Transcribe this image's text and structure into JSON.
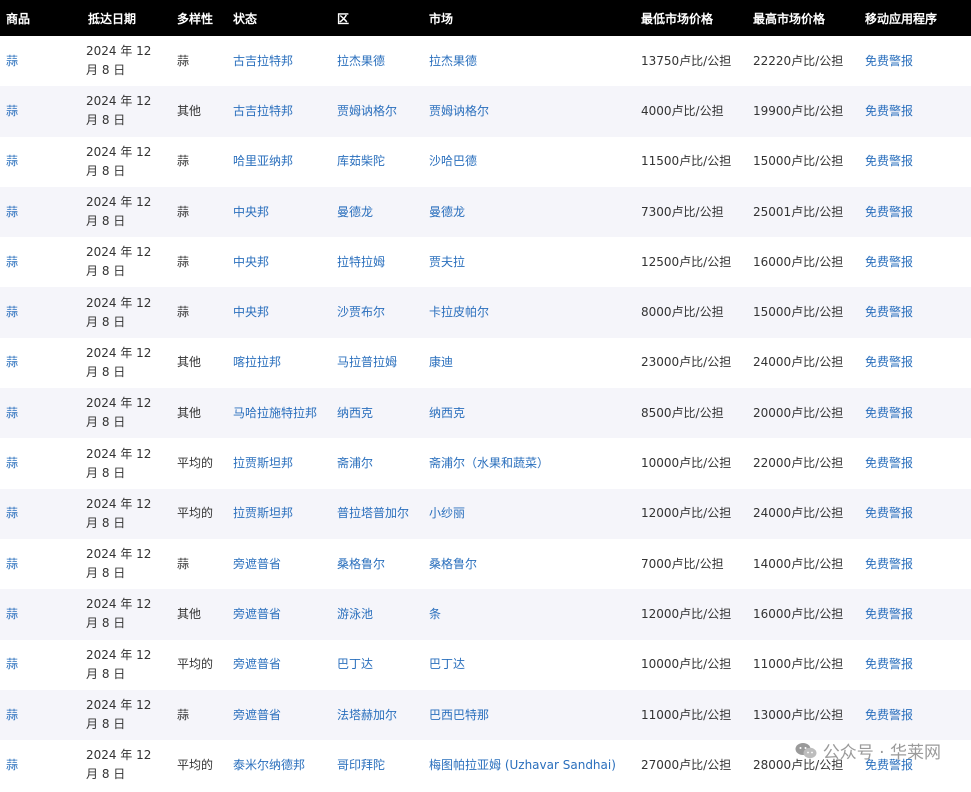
{
  "table": {
    "headers": [
      "商品",
      "抵达日期",
      "多样性",
      "状态",
      "区",
      "市场",
      "最低市场价格",
      "最高市场价格",
      "移动应用程序"
    ],
    "rows": [
      {
        "commodity": "蒜",
        "date": "2024 年 12 月 8 日",
        "variety": "蒜",
        "state": "古吉拉特邦",
        "district": "拉杰果德",
        "market": "拉杰果德",
        "min_price": "13750卢比/公担",
        "max_price": "22220卢比/公担",
        "app": "免费警报"
      },
      {
        "commodity": "蒜",
        "date": "2024 年 12 月 8 日",
        "variety": "其他",
        "state": "古吉拉特邦",
        "district": "贾姆讷格尔",
        "market": "贾姆讷格尔",
        "min_price": "4000卢比/公担",
        "max_price": "19900卢比/公担",
        "app": "免费警报"
      },
      {
        "commodity": "蒜",
        "date": "2024 年 12 月 8 日",
        "variety": "蒜",
        "state": "哈里亚纳邦",
        "district": "库茹柴陀",
        "market": "沙哈巴德",
        "min_price": "11500卢比/公担",
        "max_price": "15000卢比/公担",
        "app": "免费警报"
      },
      {
        "commodity": "蒜",
        "date": "2024 年 12 月 8 日",
        "variety": "蒜",
        "state": "中央邦",
        "district": "曼德龙",
        "market": "曼德龙",
        "min_price": "7300卢比/公担",
        "max_price": "25001卢比/公担",
        "app": "免费警报"
      },
      {
        "commodity": "蒜",
        "date": "2024 年 12 月 8 日",
        "variety": "蒜",
        "state": "中央邦",
        "district": "拉特拉姆",
        "market": "贾夫拉",
        "min_price": "12500卢比/公担",
        "max_price": "16000卢比/公担",
        "app": "免费警报"
      },
      {
        "commodity": "蒜",
        "date": "2024 年 12 月 8 日",
        "variety": "蒜",
        "state": "中央邦",
        "district": "沙贾布尔",
        "market": "卡拉皮帕尔",
        "min_price": "8000卢比/公担",
        "max_price": "15000卢比/公担",
        "app": "免费警报"
      },
      {
        "commodity": "蒜",
        "date": "2024 年 12 月 8 日",
        "variety": "其他",
        "state": "喀拉拉邦",
        "district": "马拉普拉姆",
        "market": "康迪",
        "min_price": "23000卢比/公担",
        "max_price": "24000卢比/公担",
        "app": "免费警报"
      },
      {
        "commodity": "蒜",
        "date": "2024 年 12 月 8 日",
        "variety": "其他",
        "state": "马哈拉施特拉邦",
        "district": "纳西克",
        "market": "纳西克",
        "min_price": "8500卢比/公担",
        "max_price": "20000卢比/公担",
        "app": "免费警报"
      },
      {
        "commodity": "蒜",
        "date": "2024 年 12 月 8 日",
        "variety": "平均的",
        "state": "拉贾斯坦邦",
        "district": "斋浦尔",
        "market": "斋浦尔（水果和蔬菜）",
        "min_price": "10000卢比/公担",
        "max_price": "22000卢比/公担",
        "app": "免费警报"
      },
      {
        "commodity": "蒜",
        "date": "2024 年 12 月 8 日",
        "variety": "平均的",
        "state": "拉贾斯坦邦",
        "district": "普拉塔普加尔",
        "market": "小纱丽",
        "min_price": "12000卢比/公担",
        "max_price": "24000卢比/公担",
        "app": "免费警报"
      },
      {
        "commodity": "蒜",
        "date": "2024 年 12 月 8 日",
        "variety": "蒜",
        "state": "旁遮普省",
        "district": "桑格鲁尔",
        "market": "桑格鲁尔",
        "min_price": "7000卢比/公担",
        "max_price": "14000卢比/公担",
        "app": "免费警报"
      },
      {
        "commodity": "蒜",
        "date": "2024 年 12 月 8 日",
        "variety": "其他",
        "state": "旁遮普省",
        "district": "游泳池",
        "market": "条",
        "min_price": "12000卢比/公担",
        "max_price": "16000卢比/公担",
        "app": "免费警报"
      },
      {
        "commodity": "蒜",
        "date": "2024 年 12 月 8 日",
        "variety": "平均的",
        "state": "旁遮普省",
        "district": "巴丁达",
        "market": "巴丁达",
        "min_price": "10000卢比/公担",
        "max_price": "11000卢比/公担",
        "app": "免费警报"
      },
      {
        "commodity": "蒜",
        "date": "2024 年 12 月 8 日",
        "variety": "蒜",
        "state": "旁遮普省",
        "district": "法塔赫加尔",
        "market": "巴西巴特那",
        "min_price": "11000卢比/公担",
        "max_price": "13000卢比/公担",
        "app": "免费警报"
      },
      {
        "commodity": "蒜",
        "date": "2024 年 12 月 8 日",
        "variety": "平均的",
        "state": "泰米尔纳德邦",
        "district": "哥印拜陀",
        "market": "梅图帕拉亚姆 (Uzhavar Sandhai)",
        "min_price": "27000卢比/公担",
        "max_price": "28000卢比/公担",
        "app": "免费警报"
      }
    ]
  },
  "watermark": {
    "text": "公众号 · 华莱网",
    "icon": "wechat-icon"
  },
  "colors": {
    "header_bg": "#000000",
    "header_text": "#ffffff",
    "link": "#2a6fbd",
    "stripe": "#f5f5fa"
  }
}
